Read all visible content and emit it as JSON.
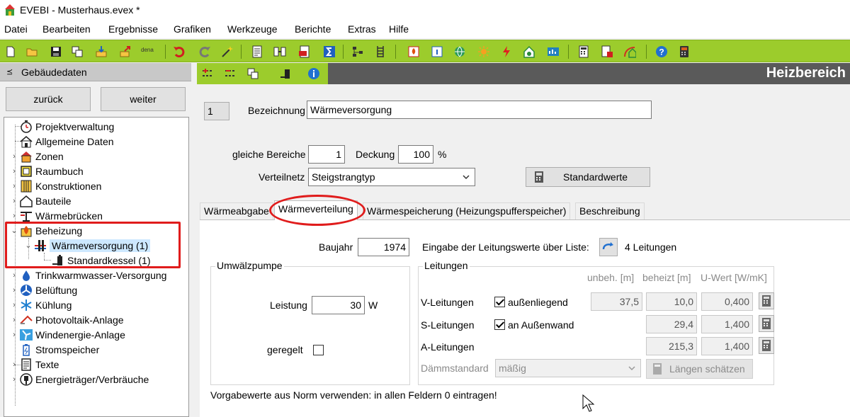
{
  "window": {
    "title": "EVEBI - Musterhaus.evex *"
  },
  "menu": [
    "Datei",
    "Bearbeiten",
    "Ergebnisse",
    "Grafiken",
    "Werkzeuge",
    "Berichte",
    "Extras",
    "Hilfe"
  ],
  "toolbar": {
    "dena_label": "dena"
  },
  "left_panel": {
    "header": "Gebäudedaten",
    "back_button": "zurück",
    "next_button": "weiter",
    "tree": [
      {
        "label": "Projektverwaltung",
        "icon": "stopwatch-icon"
      },
      {
        "label": "Allgemeine Daten",
        "icon": "house-icon"
      },
      {
        "label": "Zonen",
        "icon": "zone-house-icon"
      },
      {
        "label": "Raumbuch",
        "icon": "room-icon"
      },
      {
        "label": "Konstruktionen",
        "icon": "layers-icon"
      },
      {
        "label": "Bauteile",
        "icon": "house-outline-icon"
      },
      {
        "label": "Wärmebrücken",
        "icon": "thermal-bridge-icon"
      },
      {
        "label": "Beheizung",
        "icon": "flame-icon"
      },
      {
        "label": "Wärmeversorgung (1)",
        "icon": "heating-supply-icon"
      },
      {
        "label": "Standardkessel (1)",
        "icon": "boiler-icon"
      },
      {
        "label": "Trinkwarmwasser-Versorgung",
        "icon": "water-drop-icon"
      },
      {
        "label": "Belüftung",
        "icon": "fan-icon"
      },
      {
        "label": "Kühlung",
        "icon": "snowflake-icon"
      },
      {
        "label": "Photovoltaik-Anlage",
        "icon": "solar-panel-icon"
      },
      {
        "label": "Windenergie-Anlage",
        "icon": "wind-icon"
      },
      {
        "label": "Stromspeicher",
        "icon": "battery-icon"
      },
      {
        "label": "Texte",
        "icon": "document-icon"
      },
      {
        "label": "Energieträger/Verbräuche",
        "icon": "plug-icon"
      }
    ]
  },
  "main": {
    "heading": "Heizbereich",
    "number": "1",
    "bezeichnung_label": "Bezeichnung",
    "bezeichnung_value": "Wärmeversorgung",
    "gleiche_label": "gleiche Bereiche",
    "gleiche_value": "1",
    "deckung_label": "Deckung",
    "deckung_value": "100",
    "deckung_unit": "%",
    "verteilnetz_label": "Verteilnetz",
    "verteilnetz_value": "Steigstrangtyp",
    "standardwerte_button": "Standardwerte",
    "tabs": [
      "Wärmeabgabe",
      "Wärmeverteilung",
      "Wärmespeicherung (Heizungspufferspeicher)",
      "Beschreibung"
    ],
    "active_tab": "Wärmeverteilung",
    "baujahr_label": "Baujahr",
    "baujahr_value": "1974",
    "eingabe_label": "Eingabe der Leitungswerte über Liste:",
    "leitungen_count": "4 Leitungen",
    "pumpe": {
      "title": "Umwälzpumpe",
      "leistung_label": "Leistung",
      "leistung_value": "30",
      "leistung_unit": "W",
      "geregelt_label": "geregelt",
      "geregelt": false
    },
    "leitungen": {
      "title": "Leitungen",
      "col_unbeh": "unbeh. [m]",
      "col_beheizt": "beheizt [m]",
      "col_uwert": "U-Wert [W/mK]",
      "rows": [
        {
          "label": "V-Leitungen",
          "check_label": "außenliegend",
          "checked": true,
          "unbeh": "37,5",
          "beheizt": "10,0",
          "uwert": "0,400"
        },
        {
          "label": "S-Leitungen",
          "check_label": "an Außenwand",
          "checked": true,
          "beheizt": "29,4",
          "uwert": "1,400"
        },
        {
          "label": "A-Leitungen",
          "beheizt": "215,3",
          "uwert": "1,400"
        }
      ],
      "daemm_label": "Dämmstandard",
      "daemm_value": "mäßig",
      "laengen_button": "Längen schätzen"
    },
    "hint": "Vorgabewerte aus Norm verwenden: in allen Feldern 0 eintragen!"
  },
  "colors": {
    "toolbar_green": "#9ccc2c",
    "header_dark": "#5a5a5a",
    "highlight_red": "#e01c1c",
    "selection": "#cde8ff"
  }
}
